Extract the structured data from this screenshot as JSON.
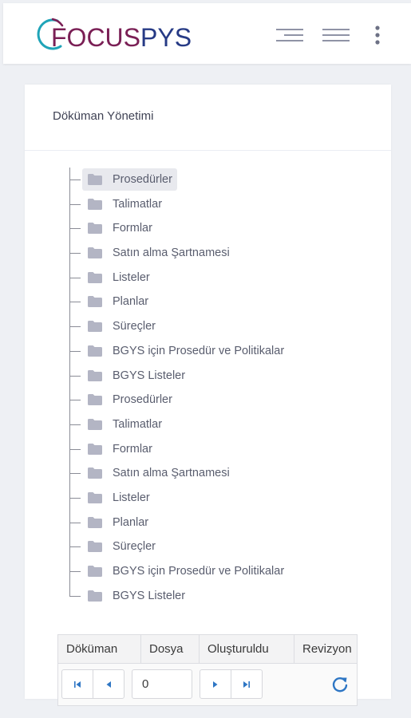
{
  "header": {
    "logo": {
      "part1": "FOCUS",
      "part2": "PYS"
    },
    "icons": [
      "align-right-menu-icon",
      "hamburger-menu-icon",
      "kebab-menu-icon"
    ]
  },
  "card": {
    "title": "Döküman Yönetimi"
  },
  "tree": {
    "selected_index": 0,
    "items": [
      "Prosedürler",
      "Talimatlar",
      "Formlar",
      "Satın alma Şartnamesi",
      "Listeler",
      "Planlar",
      "Süreçler",
      "BGYS için Prosedür ve Politikalar",
      "BGYS Listeler",
      "Prosedürler",
      "Talimatlar",
      "Formlar",
      "Satın alma Şartnamesi",
      "Listeler",
      "Planlar",
      "Süreçler",
      "BGYS için Prosedür ve Politikalar",
      "BGYS Listeler"
    ]
  },
  "grid": {
    "columns": [
      "Döküman",
      "Dosya",
      "Oluşturuldu",
      "Revizyon"
    ],
    "pager": {
      "page_value": "0"
    }
  },
  "colors": {
    "logo_focus": "#7a1f55",
    "logo_pys": "#263a85",
    "logo_ring": "#1fa4b8",
    "folder": "#b3b5c4",
    "refresh": "#2e76c4",
    "page_bg": "#eef0f4"
  }
}
